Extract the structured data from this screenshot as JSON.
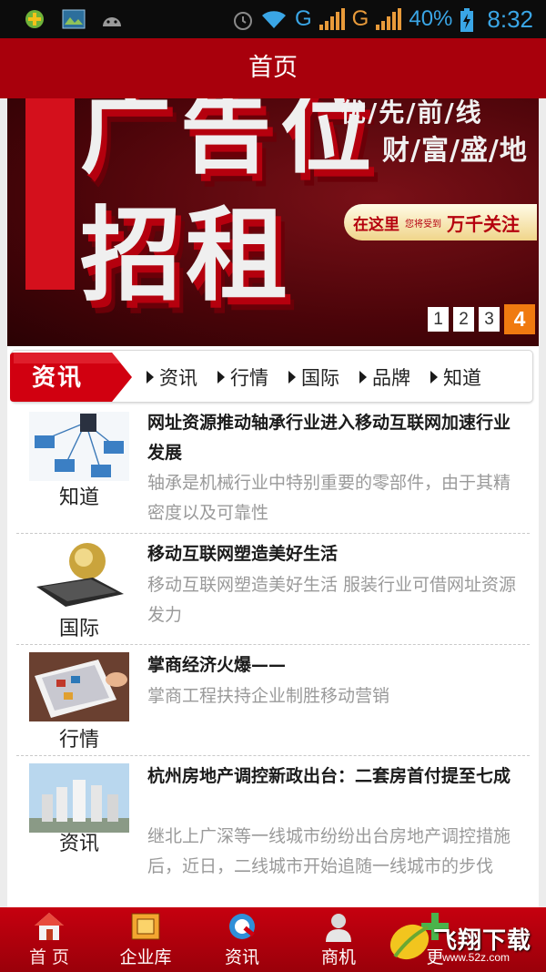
{
  "status_bar": {
    "network_label_1": "G",
    "network_label_2": "G",
    "battery": "40%",
    "time": "8:32",
    "sim1": "1",
    "sim2": "2"
  },
  "header": {
    "title": "首页"
  },
  "banner": {
    "headline_top": "广告位",
    "headline_main": "招租",
    "slogan_1": "优/先/前/线",
    "slogan_2": "财/富/盛/地",
    "pill_a": "在这里",
    "pill_b": "您将受到",
    "pill_c": "万千关注",
    "pages": [
      "1",
      "2",
      "3",
      "4"
    ],
    "active_page": "4"
  },
  "categories": {
    "label": "资讯",
    "tabs": [
      "资讯",
      "行情",
      "国际",
      "品牌",
      "知道"
    ]
  },
  "news": [
    {
      "tag": "知道",
      "title": "网址资源推动轴承行业进入移动互联网加速行业发展",
      "desc": "轴承是机械行业中特别重要的零部件，由于其精密度以及可靠性"
    },
    {
      "tag": "国际",
      "title": "移动互联网塑造美好生活",
      "desc": "移动互联网塑造美好生活 服装行业可借网址资源发力"
    },
    {
      "tag": "行情",
      "title": "掌商经济火爆——",
      "desc": "掌商工程扶持企业制胜移动营销"
    },
    {
      "tag": "资讯",
      "title": "杭州房地产调控新政出台：二套房首付提至七成",
      "desc": "继北上广深等一线城市纷纷出台房地产调控措施后，近日，二线城市开始追随一线城市的步伐"
    }
  ],
  "tabbar": {
    "items": [
      {
        "label": "首 页",
        "icon": "home-icon"
      },
      {
        "label": "企业库",
        "icon": "company-icon"
      },
      {
        "label": "资讯",
        "icon": "news-icon"
      },
      {
        "label": "商机",
        "icon": "business-icon"
      },
      {
        "label": "更",
        "icon": "more-icon"
      }
    ]
  },
  "watermark": {
    "text": "飞翔下载",
    "url": "www.52z.com"
  },
  "colors": {
    "brand_red": "#a8000c",
    "accent_orange": "#f07a10"
  }
}
